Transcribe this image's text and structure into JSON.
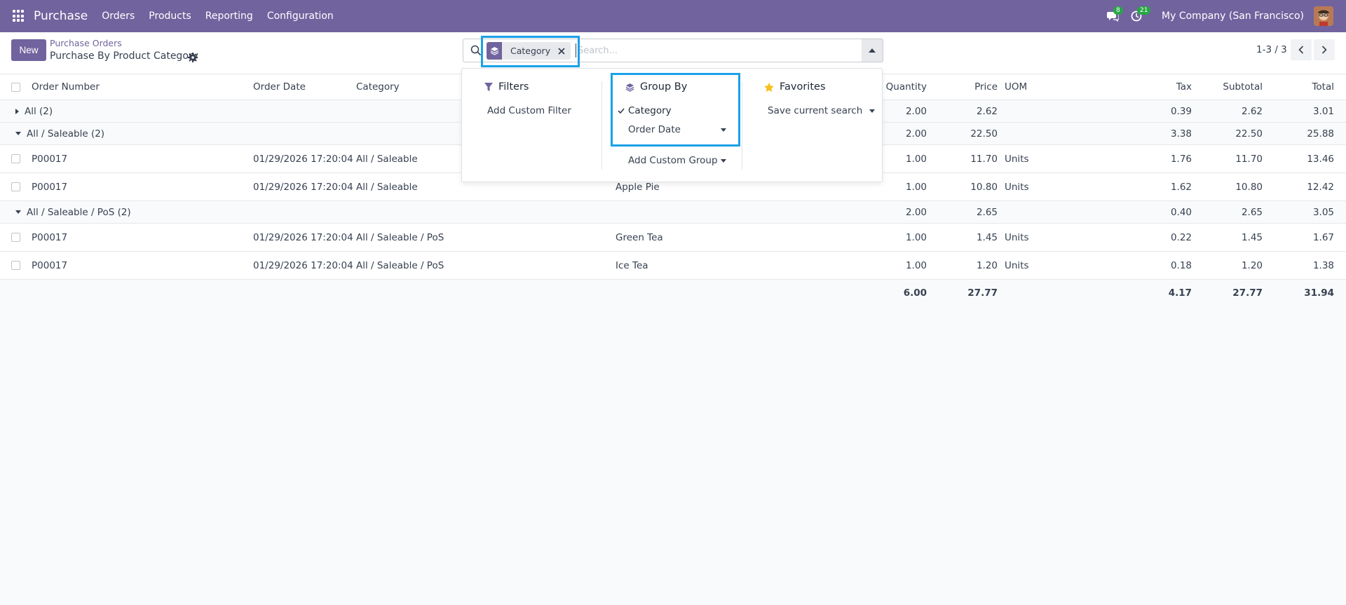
{
  "navbar": {
    "brand": "Purchase",
    "menu": [
      "Orders",
      "Products",
      "Reporting",
      "Configuration"
    ],
    "messages_count": "8",
    "activities_count": "21",
    "company": "My Company (San Francisco)"
  },
  "control": {
    "new_label": "New",
    "breadcrumb_parent": "Purchase Orders",
    "breadcrumb_current": "Purchase By Product Category",
    "pager": "1-3 / 3"
  },
  "search": {
    "facet_label": "Category",
    "placeholder": "Search..."
  },
  "dropdown": {
    "filters_title": "Filters",
    "add_custom_filter": "Add Custom Filter",
    "groupby_title": "Group By",
    "groupby_selected": "Category",
    "groupby_order_date": "Order Date",
    "add_custom_group": "Add Custom Group",
    "favorites_title": "Favorites",
    "save_current_search": "Save current search"
  },
  "table": {
    "headers": {
      "order_number": "Order Number",
      "order_date": "Order Date",
      "category": "Category",
      "quantity": "Quantity",
      "price": "Price",
      "uom": "UOM",
      "tax": "Tax",
      "subtotal": "Subtotal",
      "total": "Total"
    },
    "groups": [
      {
        "label": "All (2)",
        "quantity": "2.00",
        "price": "2.62",
        "tax": "0.39",
        "subtotal": "2.62",
        "total": "3.01"
      },
      {
        "label": "All / Saleable (2)",
        "quantity": "2.00",
        "price": "22.50",
        "tax": "3.38",
        "subtotal": "22.50",
        "total": "25.88"
      },
      {
        "label": "All / Saleable / PoS (2)",
        "quantity": "2.00",
        "price": "2.65",
        "tax": "0.40",
        "subtotal": "2.65",
        "total": "3.05"
      }
    ],
    "rows": [
      {
        "order": "P00017",
        "date": "01/29/2026 17:20:04",
        "category": "All / Saleable",
        "product": "",
        "quantity": "1.00",
        "price": "11.70",
        "uom": "Units",
        "tax": "1.76",
        "subtotal": "11.70",
        "total": "13.46"
      },
      {
        "order": "P00017",
        "date": "01/29/2026 17:20:04",
        "category": "All / Saleable",
        "product": "Apple Pie",
        "quantity": "1.00",
        "price": "10.80",
        "uom": "Units",
        "tax": "1.62",
        "subtotal": "10.80",
        "total": "12.42"
      },
      {
        "order": "P00017",
        "date": "01/29/2026 17:20:04",
        "category": "All / Saleable / PoS",
        "product": "Green Tea",
        "quantity": "1.00",
        "price": "1.45",
        "uom": "Units",
        "tax": "0.22",
        "subtotal": "1.45",
        "total": "1.67"
      },
      {
        "order": "P00017",
        "date": "01/29/2026 17:20:04",
        "category": "All / Saleable / PoS",
        "product": "Ice Tea",
        "quantity": "1.00",
        "price": "1.20",
        "uom": "Units",
        "tax": "0.18",
        "subtotal": "1.20",
        "total": "1.38"
      }
    ],
    "totals": {
      "quantity": "6.00",
      "price": "27.77",
      "tax": "4.17",
      "subtotal": "27.77",
      "total": "31.94"
    }
  },
  "colors": {
    "brand": "#71639e",
    "highlight": "#1aa1e8",
    "badge": "#28a745"
  }
}
